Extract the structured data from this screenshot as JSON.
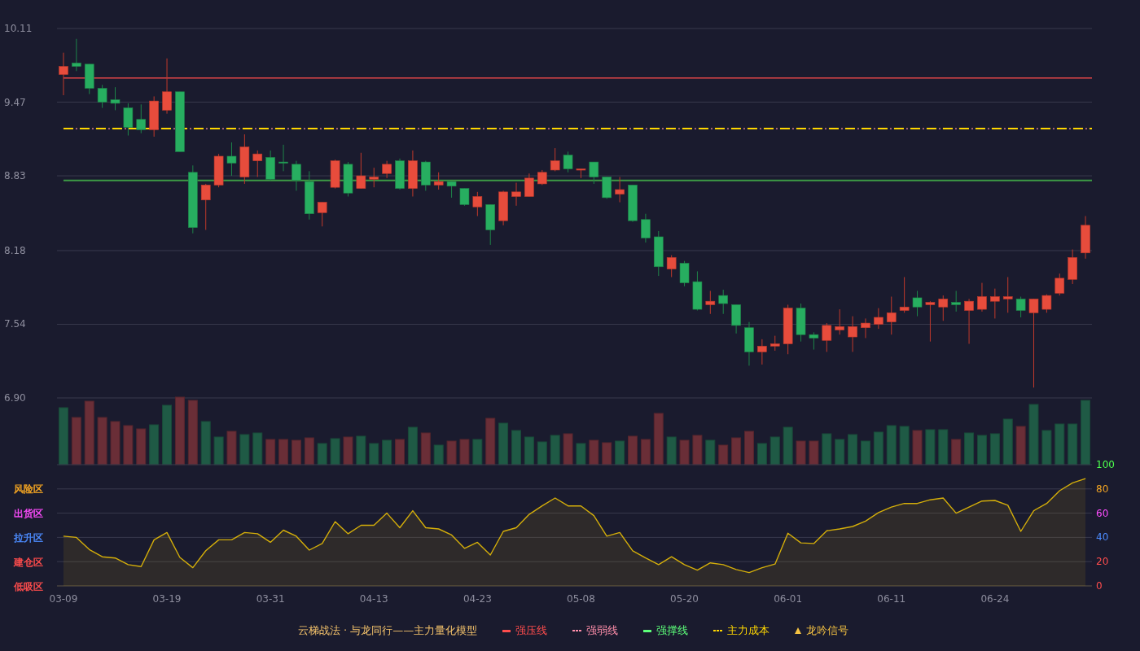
{
  "price_chart": {
    "chart_data": {
      "type": "candlestick",
      "categories": [
        null,
        null,
        null,
        null,
        null,
        null,
        null,
        null,
        null,
        null,
        null,
        null,
        null,
        null,
        null,
        null,
        null,
        null,
        null,
        null,
        null,
        null,
        null,
        null,
        null,
        null,
        null,
        null,
        null,
        null,
        null,
        null,
        null,
        null,
        null,
        null,
        null,
        null,
        null,
        null,
        null,
        null,
        null,
        null,
        null,
        null,
        null,
        null,
        null,
        null,
        null,
        null,
        null,
        null,
        null,
        null,
        null,
        null,
        null,
        null,
        null,
        null,
        null,
        null,
        null,
        null,
        null,
        null,
        null,
        null,
        null,
        null,
        null,
        null,
        null,
        null,
        null,
        null,
        null,
        null
      ],
      "ohlc": [
        [
          9.71,
          9.9,
          9.53,
          9.78
        ],
        [
          9.81,
          10.02,
          9.74,
          9.78
        ],
        [
          9.8,
          9.8,
          9.54,
          9.59
        ],
        [
          9.59,
          9.62,
          9.42,
          9.47
        ],
        [
          9.49,
          9.6,
          9.4,
          9.46
        ],
        [
          9.42,
          9.46,
          9.18,
          9.25
        ],
        [
          9.32,
          9.45,
          9.2,
          9.23
        ],
        [
          9.23,
          9.52,
          9.17,
          9.48
        ],
        [
          9.4,
          9.85,
          9.37,
          9.56
        ],
        [
          9.56,
          9.56,
          9.04,
          9.04
        ],
        [
          8.86,
          8.92,
          8.33,
          8.38
        ],
        [
          8.62,
          8.76,
          8.36,
          8.75
        ],
        [
          8.75,
          9.02,
          8.73,
          9.0
        ],
        [
          9.0,
          9.12,
          8.83,
          8.94
        ],
        [
          8.82,
          9.19,
          8.76,
          9.08
        ],
        [
          8.96,
          9.05,
          8.82,
          9.02
        ],
        [
          8.99,
          9.05,
          8.79,
          8.8
        ],
        [
          8.95,
          9.1,
          8.87,
          8.94
        ],
        [
          8.93,
          8.96,
          8.7,
          8.79
        ],
        [
          8.78,
          8.87,
          8.45,
          8.5
        ],
        [
          8.51,
          8.6,
          8.39,
          8.6
        ],
        [
          8.73,
          8.97,
          8.72,
          8.96
        ],
        [
          8.93,
          8.95,
          8.65,
          8.68
        ],
        [
          8.72,
          9.03,
          8.72,
          8.83
        ],
        [
          8.8,
          8.9,
          8.73,
          8.82
        ],
        [
          8.85,
          8.96,
          8.81,
          8.93
        ],
        [
          8.96,
          8.98,
          8.71,
          8.72
        ],
        [
          8.72,
          9.05,
          8.65,
          8.96
        ],
        [
          8.95,
          8.96,
          8.7,
          8.75
        ],
        [
          8.75,
          8.86,
          8.71,
          8.78
        ],
        [
          8.78,
          8.78,
          8.64,
          8.74
        ],
        [
          8.72,
          8.72,
          8.57,
          8.58
        ],
        [
          8.56,
          8.69,
          8.48,
          8.65
        ],
        [
          8.58,
          8.58,
          8.23,
          8.36
        ],
        [
          8.44,
          8.7,
          8.4,
          8.69
        ],
        [
          8.65,
          8.77,
          8.57,
          8.69
        ],
        [
          8.65,
          8.85,
          8.65,
          8.81
        ],
        [
          8.76,
          8.88,
          8.75,
          8.86
        ],
        [
          8.88,
          9.07,
          8.87,
          8.96
        ],
        [
          9.01,
          9.04,
          8.86,
          8.89
        ],
        [
          8.88,
          8.89,
          8.81,
          8.89
        ],
        [
          8.95,
          8.95,
          8.76,
          8.82
        ],
        [
          8.82,
          8.82,
          8.63,
          8.64
        ],
        [
          8.67,
          8.82,
          8.6,
          8.71
        ],
        [
          8.75,
          8.75,
          8.43,
          8.44
        ],
        [
          8.45,
          8.5,
          8.25,
          8.29
        ],
        [
          8.3,
          8.35,
          7.96,
          8.04
        ],
        [
          8.02,
          8.14,
          7.95,
          8.12
        ],
        [
          8.07,
          8.09,
          7.87,
          7.9
        ],
        [
          7.91,
          8.0,
          7.66,
          7.67
        ],
        [
          7.71,
          7.83,
          7.63,
          7.74
        ],
        [
          7.79,
          7.84,
          7.63,
          7.72
        ],
        [
          7.71,
          7.71,
          7.46,
          7.53
        ],
        [
          7.51,
          7.56,
          7.18,
          7.3
        ],
        [
          7.3,
          7.41,
          7.19,
          7.35
        ],
        [
          7.35,
          7.44,
          7.31,
          7.37
        ],
        [
          7.37,
          7.71,
          7.28,
          7.68
        ],
        [
          7.68,
          7.72,
          7.39,
          7.45
        ],
        [
          7.45,
          7.47,
          7.32,
          7.42
        ],
        [
          7.4,
          7.55,
          7.3,
          7.53
        ],
        [
          7.49,
          7.67,
          7.45,
          7.52
        ],
        [
          7.43,
          7.61,
          7.3,
          7.52
        ],
        [
          7.51,
          7.59,
          7.42,
          7.55
        ],
        [
          7.54,
          7.68,
          7.5,
          7.6
        ],
        [
          7.56,
          7.78,
          7.45,
          7.64
        ],
        [
          7.66,
          7.95,
          7.64,
          7.69
        ],
        [
          7.77,
          7.83,
          7.61,
          7.69
        ],
        [
          7.71,
          7.74,
          7.39,
          7.73
        ],
        [
          7.69,
          7.79,
          7.57,
          7.76
        ],
        [
          7.73,
          7.83,
          7.65,
          7.71
        ],
        [
          7.66,
          7.76,
          7.37,
          7.74
        ],
        [
          7.67,
          7.9,
          7.65,
          7.78
        ],
        [
          7.74,
          7.85,
          7.59,
          7.78
        ],
        [
          7.76,
          7.95,
          7.64,
          7.78
        ],
        [
          7.76,
          7.78,
          7.6,
          7.66
        ],
        [
          7.64,
          7.76,
          6.99,
          7.76
        ],
        [
          7.67,
          7.8,
          7.64,
          7.79
        ],
        [
          7.81,
          7.98,
          7.79,
          7.94
        ],
        [
          7.93,
          8.19,
          7.89,
          8.12
        ],
        [
          8.16,
          8.48,
          8.11,
          8.4
        ]
      ],
      "ylim": [
        6.9,
        10.11
      ],
      "yticks": [
        {
          "value": 10.11,
          "label": "10.11"
        },
        {
          "value": 9.47,
          "label": "9.47"
        },
        {
          "value": 8.83,
          "label": "8.83"
        },
        {
          "value": 8.18,
          "label": "8.18"
        },
        {
          "value": 7.54,
          "label": "7.54"
        },
        {
          "value": 6.9,
          "label": "6.90"
        }
      ],
      "grid": true,
      "ref_lines": [
        {
          "axis": "y",
          "value": 9.68,
          "color": "#ff4d4d"
        },
        {
          "axis": "y",
          "value": 9.24,
          "color": "#ff8fab"
        },
        {
          "axis": "y",
          "value": 8.79,
          "color": "#3d9a45"
        },
        {
          "axis": "y",
          "value": 9.24,
          "color": "#ffd700"
        }
      ]
    }
  },
  "indicator_chart": {
    "zones": [
      {
        "label": "风险区",
        "color": "#f5a623"
      },
      {
        "label": "出货区",
        "color": "#ff4dff"
      },
      {
        "label": "拉升区",
        "color": "#4d8cff"
      },
      {
        "label": "建仓区",
        "color": "#ff4d4d"
      },
      {
        "label": "低吸区",
        "color": "#ff4d4d"
      }
    ],
    "chart_data": {
      "type": "area",
      "categories": [
        "03-09",
        null,
        null,
        null,
        null,
        null,
        null,
        null,
        "03-19",
        null,
        null,
        null,
        null,
        null,
        null,
        null,
        "03-31",
        null,
        null,
        null,
        null,
        null,
        null,
        null,
        "04-13",
        null,
        null,
        null,
        null,
        null,
        null,
        null,
        "04-23",
        null,
        null,
        null,
        null,
        null,
        null,
        null,
        "05-08",
        null,
        null,
        null,
        null,
        null,
        null,
        null,
        "05-20",
        null,
        null,
        null,
        null,
        null,
        null,
        null,
        "06-01",
        null,
        null,
        null,
        null,
        null,
        null,
        null,
        "06-11",
        null,
        null,
        null,
        null,
        null,
        null,
        null,
        "06-24",
        null,
        null,
        null,
        null,
        null,
        null,
        null
      ],
      "values": [
        41,
        40,
        30,
        24,
        23,
        17.5,
        16,
        38,
        44,
        23.5,
        15,
        29,
        38,
        38,
        44,
        43,
        36,
        46,
        41,
        29.5,
        35,
        53,
        43,
        50,
        50,
        60,
        48,
        62,
        48,
        47,
        42,
        31,
        36,
        25.5,
        45,
        48,
        59,
        66,
        72.5,
        66,
        66,
        58,
        41,
        44,
        29,
        23,
        17.5,
        24,
        17.5,
        13,
        19,
        17.5,
        13.5,
        11,
        15,
        18,
        43.5,
        35.5,
        35,
        45.5,
        47,
        49,
        53.5,
        60.5,
        65,
        68,
        68,
        71,
        72.5,
        60,
        65,
        70,
        70.5,
        66.5,
        45,
        62,
        68,
        78.5,
        85,
        88.5
      ],
      "ylim": [
        0,
        100
      ],
      "yticks": [
        0,
        20,
        40,
        60,
        80,
        100
      ],
      "grid": true
    }
  },
  "legend": {
    "title": "云梯战法 · 与龙同行——主力量化模型",
    "items": [
      {
        "label": "强压线",
        "kind": "solid",
        "color": "#ff4d4d"
      },
      {
        "label": "强弱线",
        "kind": "dashed",
        "color": "#ff8fab"
      },
      {
        "label": "强撑线",
        "kind": "solid",
        "color": "#5dff7a"
      },
      {
        "label": "主力成本",
        "kind": "dashed",
        "color": "#ffd700"
      },
      {
        "label": "龙吟信号",
        "kind": "triangle",
        "color": "#f5c242"
      }
    ]
  }
}
